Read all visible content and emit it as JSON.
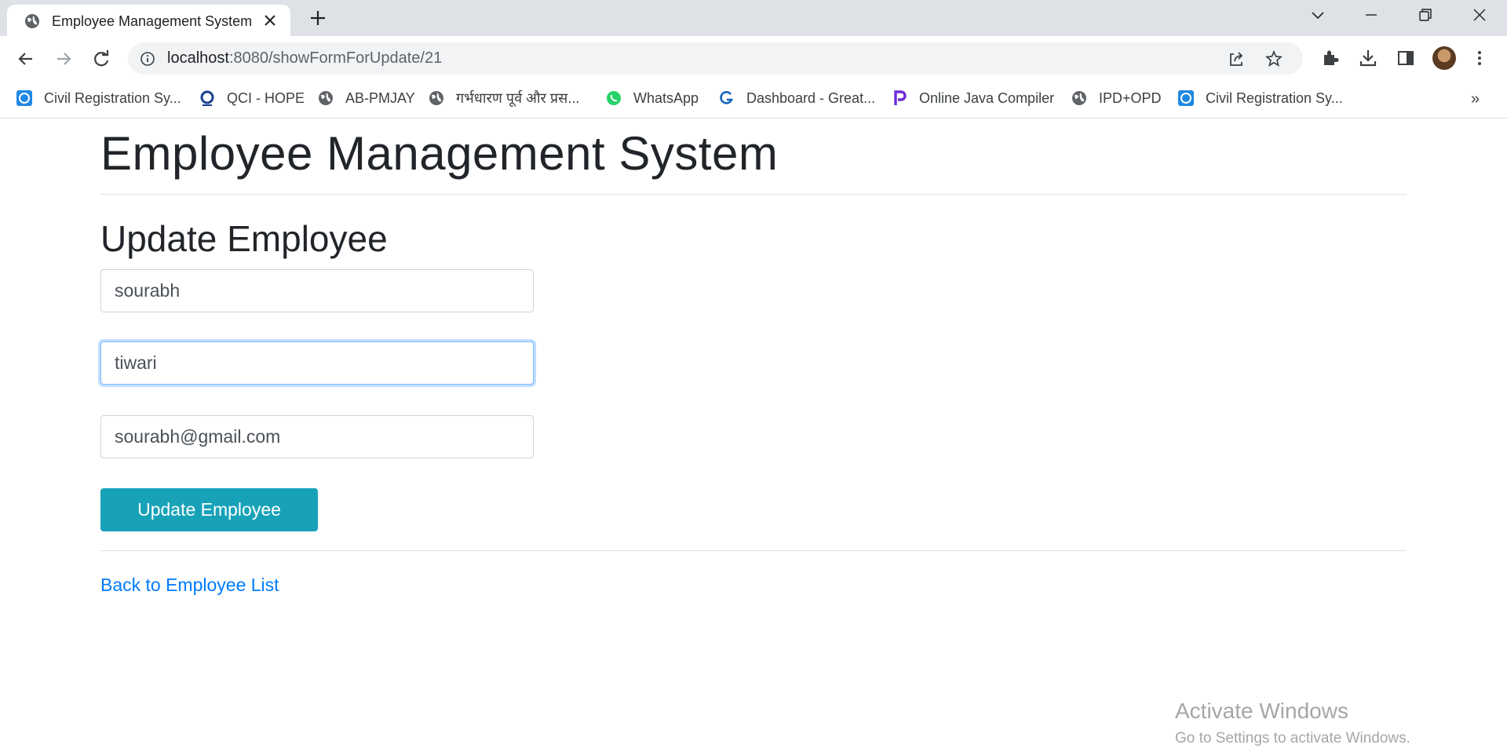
{
  "browser": {
    "tab": {
      "title": "Employee Management System"
    },
    "url": {
      "host": "localhost",
      "path": ":8080/showFormForUpdate/21"
    },
    "bookmarks": [
      "Civil Registration Sy...",
      "QCI - HOPE",
      "AB-PMJAY",
      "गर्भधारण पूर्व और प्रस...",
      "WhatsApp",
      "Dashboard - Great...",
      "Online Java Compiler",
      "IPD+OPD",
      "Civil Registration Sy..."
    ],
    "bookmarks_more": "»"
  },
  "page": {
    "title": "Employee Management System",
    "form_heading": "Update Employee",
    "fields": {
      "first_name": "sourabh",
      "last_name": "tiwari",
      "email": "sourabh@gmail.com"
    },
    "submit_label": "Update Employee",
    "back_link": "Back to Employee List"
  },
  "watermark": {
    "line1": "Activate Windows",
    "line2": "Go to Settings to activate Windows."
  },
  "colors": {
    "button_bg": "#17a2b8",
    "link": "#007bff",
    "focus_border": "#80bdff"
  }
}
